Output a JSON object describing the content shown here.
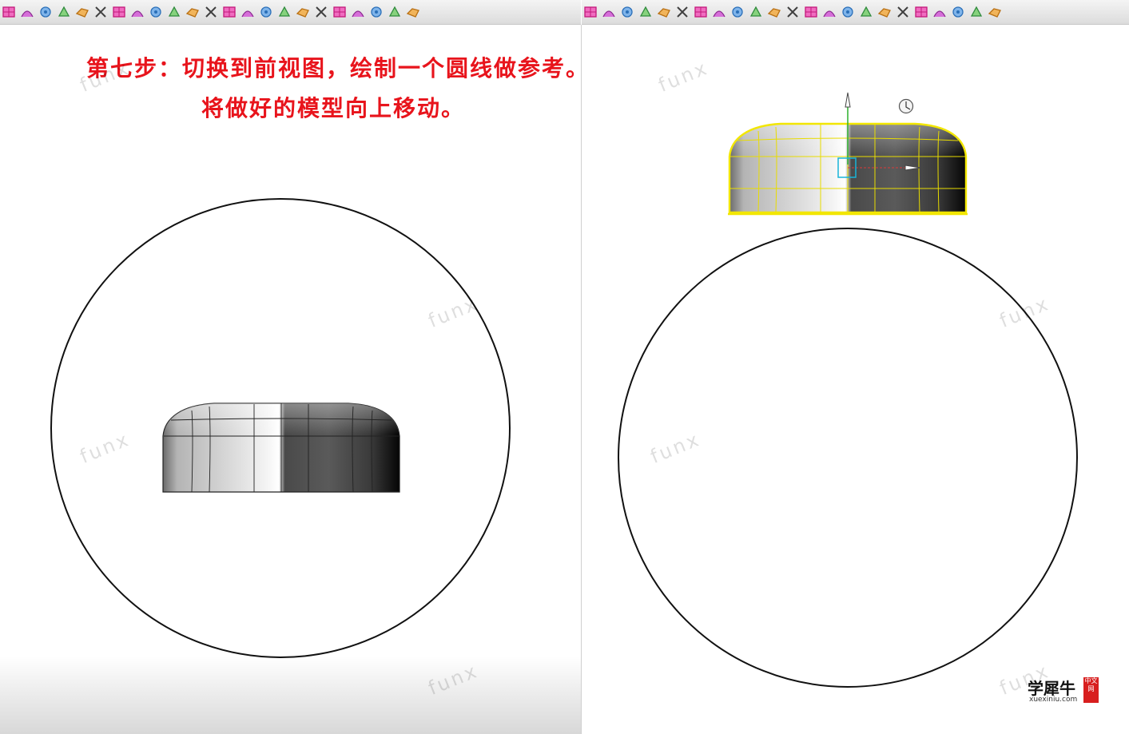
{
  "caption": {
    "line1": "第七步：切换到前视图，绘制一个圆线做参考。",
    "line2": "将做好的模型向上移动。"
  },
  "watermark_text": "funx",
  "logo": {
    "name": "学犀牛",
    "domain": "xuexiniu.com",
    "seal": "中文网"
  },
  "toolbar_icons": [
    "surface-from-curves-icon",
    "loft-icon",
    "blend-icon",
    "extrude-icon",
    "sweep-icon",
    "rail-revolve-icon",
    "network-surface-icon",
    "patch-icon",
    "fillet-edge-icon",
    "chamfer-icon",
    "offset-surface-icon",
    "split-icon",
    "trim-icon",
    "join-icon",
    "explode-icon",
    "boolean-icon",
    "rebuild-icon",
    "match-surface-icon",
    "point-edit-icon",
    "analyze-icon",
    "mesh-icon",
    "render-icon",
    "curvature-icon"
  ],
  "colors": {
    "caption": "#e8141c",
    "selection": "#f2e600",
    "circle": "#111111"
  }
}
